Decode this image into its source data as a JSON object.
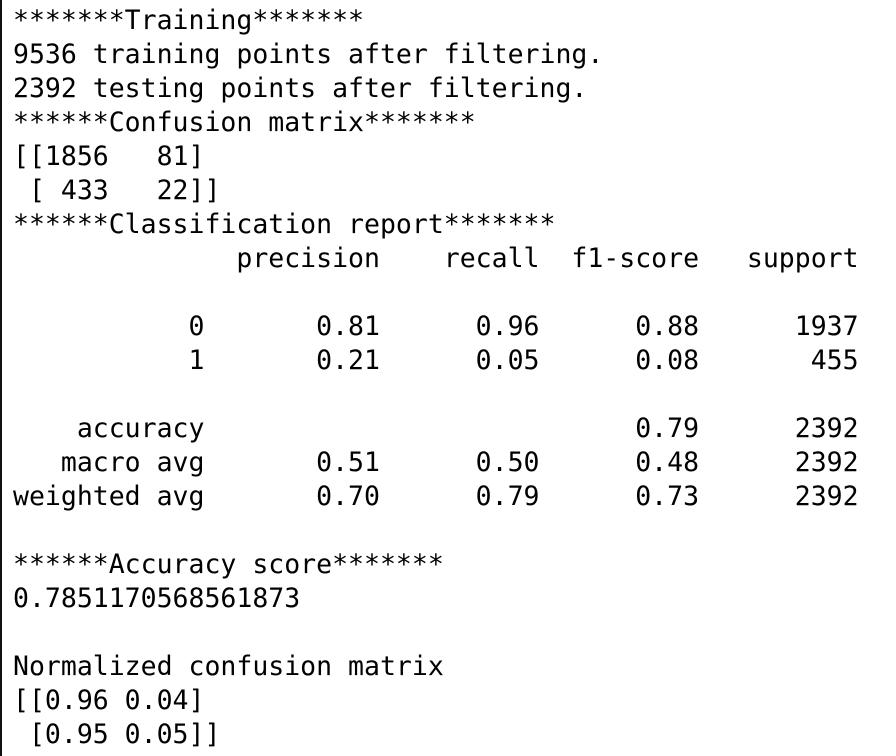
{
  "terminal": {
    "cut_line": "   -  7",
    "lines": [
      "*******Training*******",
      "9536 training points after filtering.",
      "2392 testing points after filtering.",
      "******Confusion matrix*******",
      "[[1856   81]",
      " [ 433   22]]",
      "******Classification report*******",
      "              precision    recall  f1-score   support",
      "",
      "           0       0.81      0.96      0.88      1937",
      "           1       0.21      0.05      0.08       455",
      "",
      "    accuracy                           0.79      2392",
      "   macro avg       0.51      0.50      0.48      2392",
      "weighted avg       0.70      0.79      0.73      2392",
      "",
      "******Accuracy score*******",
      "0.7851170568561873",
      "",
      "Normalized confusion matrix",
      "[[0.96 0.04]",
      " [0.95 0.05]]"
    ]
  },
  "colors": {
    "background": "#ffffff",
    "text": "#000000",
    "left_border": "#111111"
  }
}
